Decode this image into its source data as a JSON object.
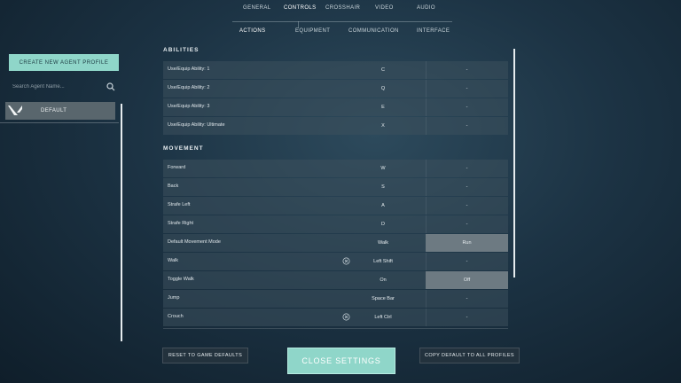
{
  "top_nav": [
    {
      "label": "GENERAL",
      "active": false
    },
    {
      "label": "CONTROLS",
      "active": true
    },
    {
      "label": "CROSSHAIR",
      "active": false
    },
    {
      "label": "VIDEO",
      "active": false
    },
    {
      "label": "AUDIO",
      "active": false
    }
  ],
  "sub_nav": [
    {
      "label": "ACTIONS",
      "active": true
    },
    {
      "label": "EQUIPMENT",
      "active": false
    },
    {
      "label": "COMMUNICATION",
      "active": false
    },
    {
      "label": "INTERFACE",
      "active": false
    }
  ],
  "left_panel": {
    "create_button": "CREATE NEW AGENT PROFILE",
    "search_placeholder": "Search Agent Name...",
    "profile_label": "DEFAULT"
  },
  "sections": {
    "abilities": {
      "title": "ABILITIES",
      "rows": [
        {
          "label": "Use/Equip Ability: 1",
          "primary": "C",
          "secondary": "-"
        },
        {
          "label": "Use/Equip Ability: 2",
          "primary": "Q",
          "secondary": "-"
        },
        {
          "label": "Use/Equip Ability: 3",
          "primary": "E",
          "secondary": "-"
        },
        {
          "label": "Use/Equip Ability: Ultimate",
          "primary": "X",
          "secondary": "-"
        }
      ]
    },
    "movement": {
      "title": "MOVEMENT",
      "rows": [
        {
          "label": "Forward",
          "primary": "W",
          "secondary": "-"
        },
        {
          "label": "Back",
          "primary": "S",
          "secondary": "-"
        },
        {
          "label": "Strafe Left",
          "primary": "A",
          "secondary": "-"
        },
        {
          "label": "Strafe Right",
          "primary": "D",
          "secondary": "-"
        },
        {
          "label": "Default Movement Mode",
          "primary": "Walk",
          "secondary": "Run"
        },
        {
          "label": "Walk",
          "primary": "Left Shift",
          "secondary": "-"
        },
        {
          "label": "Toggle Walk",
          "primary": "On",
          "secondary": "Off"
        },
        {
          "label": "Jump",
          "primary": "Space Bar",
          "secondary": "-"
        },
        {
          "label": "Crouch",
          "primary": "Left Ctrl",
          "secondary": "-"
        }
      ]
    }
  },
  "bottom": {
    "reset": "RESET TO GAME DEFAULTS",
    "close": "CLOSE SETTINGS",
    "copy": "COPY DEFAULT TO ALL PROFILES"
  }
}
